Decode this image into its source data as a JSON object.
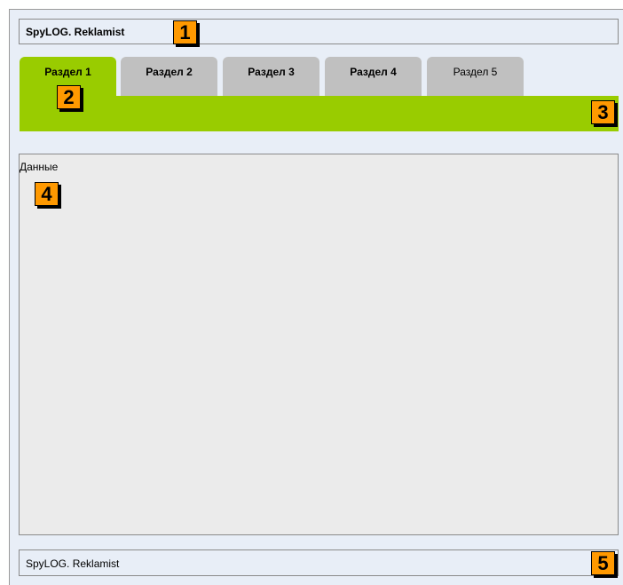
{
  "header": {
    "title": "SpyLOG. Reklamist"
  },
  "tabs": [
    {
      "label": "Раздел 1",
      "active": true
    },
    {
      "label": "Раздел 2",
      "active": false
    },
    {
      "label": "Раздел 3",
      "active": false
    },
    {
      "label": "Раздел 4",
      "active": false
    },
    {
      "label": "Раздел 5",
      "active": false
    }
  ],
  "content": {
    "label": "Данные"
  },
  "footer": {
    "text": "SpyLOG. Reklamist"
  },
  "badges": [
    "1",
    "2",
    "3",
    "4",
    "5"
  ],
  "colors": {
    "background": "#e8eef7",
    "tab_active": "#99cc00",
    "tab_inactive": "#c0c0c0",
    "content_bg": "#ebebeb",
    "badge": "#ff9900"
  }
}
